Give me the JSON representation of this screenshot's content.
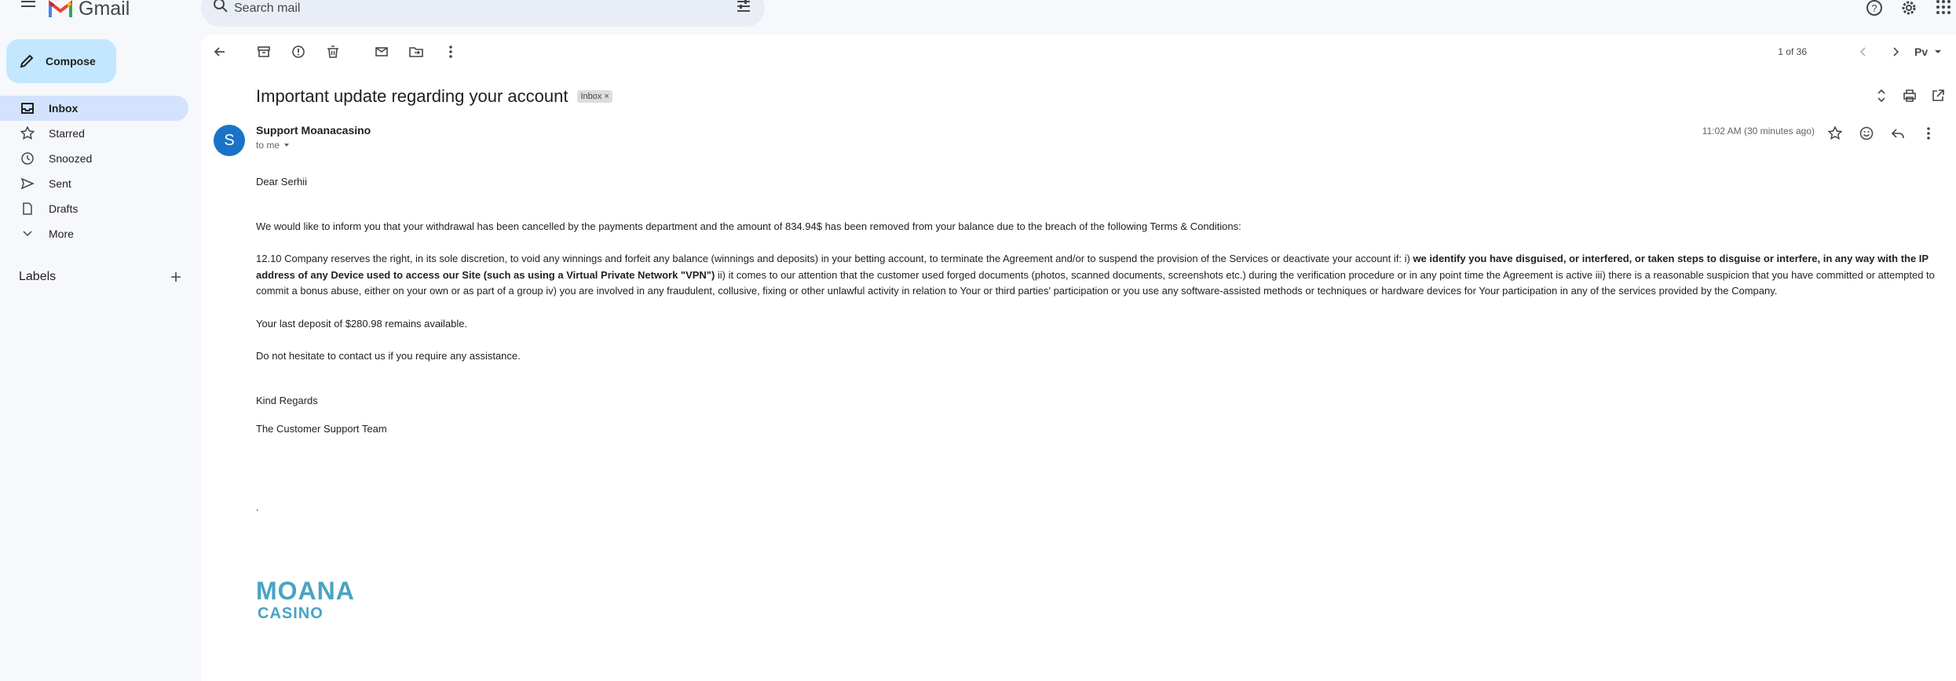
{
  "app": {
    "name": "Gmail"
  },
  "search": {
    "placeholder": "Search mail"
  },
  "compose": {
    "label": "Compose"
  },
  "sidebar": {
    "items": [
      {
        "label": "Inbox",
        "icon": "inbox-icon",
        "active": true
      },
      {
        "label": "Starred",
        "icon": "star-icon"
      },
      {
        "label": "Snoozed",
        "icon": "clock-icon"
      },
      {
        "label": "Sent",
        "icon": "send-icon"
      },
      {
        "label": "Drafts",
        "icon": "draft-icon"
      },
      {
        "label": "More",
        "icon": "chevron-down-icon"
      }
    ],
    "labels_title": "Labels"
  },
  "toolbar": {
    "pager": "1 of 36"
  },
  "email": {
    "subject": "Important update regarding your account",
    "label_chip": "Inbox",
    "sender_initial": "S",
    "sender": "Support Moanacasino",
    "to": "to me",
    "time": "11:02 AM (30 minutes ago)",
    "greeting": "Dear Serhii",
    "para1": "We would like to inform you that your withdrawal has been cancelled by the payments department and the amount of 834.94$ has been removed from your balance due to the breach of the following Terms & Conditions:",
    "para2_a": "12.10 Company reserves the right, in its sole discretion, to void any winnings and forfeit any balance (winnings and deposits) in your betting account, to terminate the Agreement and/or to suspend the provision of the Services or deactivate your account if: i) ",
    "para2_bold": "we identify you have disguised, or interfered, or taken steps to disguise or interfere, in any way with the IP address of any Device used to access our Site (such as using a Virtual Private Network \"VPN\")",
    "para2_b": " ii) it comes to our attention that the customer used forged documents (photos, scanned documents, screenshots etc.) during the verification procedure or in any point time the Agreement is active iii) there is a reasonable suspicion that you have committed or attempted to commit a bonus abuse, either on your own or as part of a group iv) you are involved in any fraudulent, collusive, fixing or other unlawful activity in relation to Your or third parties' participation or you use any software-assisted methods or techniques or hardware devices for Your participation in any of the services provided by the Company.",
    "para3": "Your last deposit of $280.98 remains available.",
    "para4": "Do not hesitate to contact us if you require any assistance.",
    "sign1": "Kind Regards",
    "sign2": "The Customer Support Team",
    "dot": ".",
    "logo_line1": "MOANA",
    "logo_line2": "CASINO"
  },
  "colors": {
    "accent": "#c2e7ff",
    "active_nav": "#d3e3fd",
    "avatar": "#1a73c8",
    "logo": "#4aa3c2"
  }
}
